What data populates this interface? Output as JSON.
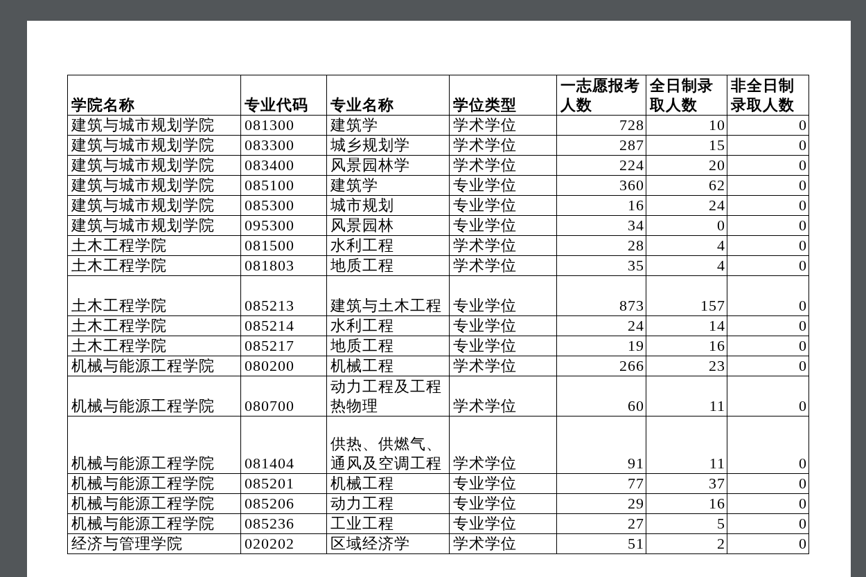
{
  "table": {
    "columns": [
      "学院名称",
      "专业代码",
      "专业名称",
      "学位类型",
      "一志愿报考人数",
      "全日制录取人数",
      "非全日制录取人数"
    ],
    "rows": [
      [
        "建筑与城市规划学院",
        "081300",
        "建筑学",
        "学术学位",
        "728",
        "10",
        "0"
      ],
      [
        "建筑与城市规划学院",
        "083300",
        "城乡规划学",
        "学术学位",
        "287",
        "15",
        "0"
      ],
      [
        "建筑与城市规划学院",
        "083400",
        "风景园林学",
        "学术学位",
        "224",
        "20",
        "0"
      ],
      [
        "建筑与城市规划学院",
        "085100",
        "建筑学",
        "专业学位",
        "360",
        "62",
        "0"
      ],
      [
        "建筑与城市规划学院",
        "085300",
        "城市规划",
        "专业学位",
        "16",
        "24",
        "0"
      ],
      [
        "建筑与城市规划学院",
        "095300",
        "风景园林",
        "专业学位",
        "34",
        "0",
        "0"
      ],
      [
        "土木工程学院",
        "081500",
        "水利工程",
        "学术学位",
        "28",
        "4",
        "0"
      ],
      [
        "土木工程学院",
        "081803",
        "地质工程",
        "学术学位",
        "35",
        "4",
        "0"
      ],
      [
        "土木工程学院",
        "085213",
        "建筑与土木工程",
        "专业学位",
        "873",
        "157",
        "0"
      ],
      [
        "土木工程学院",
        "085214",
        "水利工程",
        "专业学位",
        "24",
        "14",
        "0"
      ],
      [
        "土木工程学院",
        "085217",
        "地质工程",
        "专业学位",
        "19",
        "16",
        "0"
      ],
      [
        "机械与能源工程学院",
        "080200",
        "机械工程",
        "学术学位",
        "266",
        "23",
        "0"
      ],
      [
        "机械与能源工程学院",
        "080700",
        "动力工程及工程热物理",
        "学术学位",
        "60",
        "11",
        "0"
      ],
      [
        "机械与能源工程学院",
        "081404",
        "供热、供燃气、通风及空调工程",
        "学术学位",
        "91",
        "11",
        "0"
      ],
      [
        "机械与能源工程学院",
        "085201",
        "机械工程",
        "专业学位",
        "77",
        "37",
        "0"
      ],
      [
        "机械与能源工程学院",
        "085206",
        "动力工程",
        "专业学位",
        "29",
        "16",
        "0"
      ],
      [
        "机械与能源工程学院",
        "085236",
        "工业工程",
        "专业学位",
        "27",
        "5",
        "0"
      ],
      [
        "经济与管理学院",
        "020202",
        "区域经济学",
        "学术学位",
        "51",
        "2",
        "0"
      ]
    ]
  }
}
